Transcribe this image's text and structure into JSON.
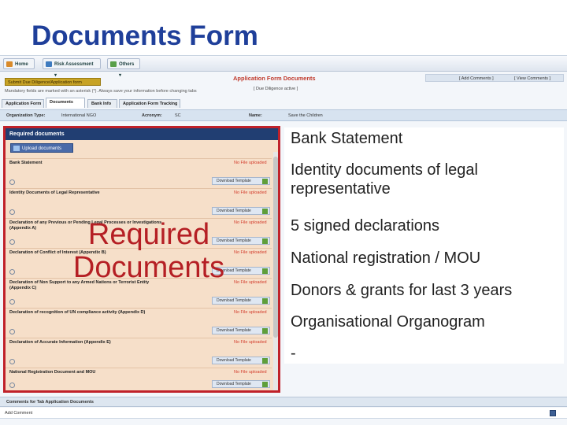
{
  "slide": {
    "title": "Documents Form"
  },
  "nav": {
    "home": "Home",
    "risk": "Risk Assessment ▾",
    "others": "Others ▾"
  },
  "form": {
    "submit_label": "Submit Due Diligence/Application form",
    "mandatory_note": "Mandatory fields are marked with an asterisk (*). Always save your information before changing tabs",
    "heading": "Application Form Documents",
    "status": "[ Due Diligence active ]",
    "add_comments": "[ Add Comments ]",
    "view_comments": "[ View Comments ]"
  },
  "tabs": [
    "Application Form",
    "Documents",
    "Bank Info",
    "Application Form Tracking"
  ],
  "info": {
    "org_type_label": "Organization Type:",
    "org_type_value": "International NGO",
    "acronym_label": "Acronym:",
    "acronym_value": "SC",
    "name_label": "Name:",
    "name_value": "Save the Children"
  },
  "panel": {
    "header": "Required documents",
    "upload_label": "Upload documents",
    "status_text": "No File uploaded",
    "template_label": "Download Template",
    "documents": [
      "Bank Statement",
      "Identity Documents of Legal Representative",
      "Declaration of any Previous or Pending Legal Processes or Investigations (Appendix A)",
      "Declaration of Conflict of Interest (Appendix B)",
      "Declaration of Non Support to any Armed Nations or Terrorist Entity (Appendix C)",
      "Declaration of recognition of UN compliance activity (Appendix D)",
      "Declaration of Accurate Information (Appendix E)",
      "National Registration Document and MOU"
    ]
  },
  "overlay": {
    "line1": "Required",
    "line2": "Documents"
  },
  "bullets": [
    "Bank Statement",
    "Identity documents of legal representative",
    "5 signed declarations",
    "National registration / MOU",
    "Donors & grants for last 3 years",
    "Organisational Organogram",
    "-"
  ],
  "comments": {
    "title": "Comments for Tab Application Documents",
    "input_label": "Add Comment"
  }
}
